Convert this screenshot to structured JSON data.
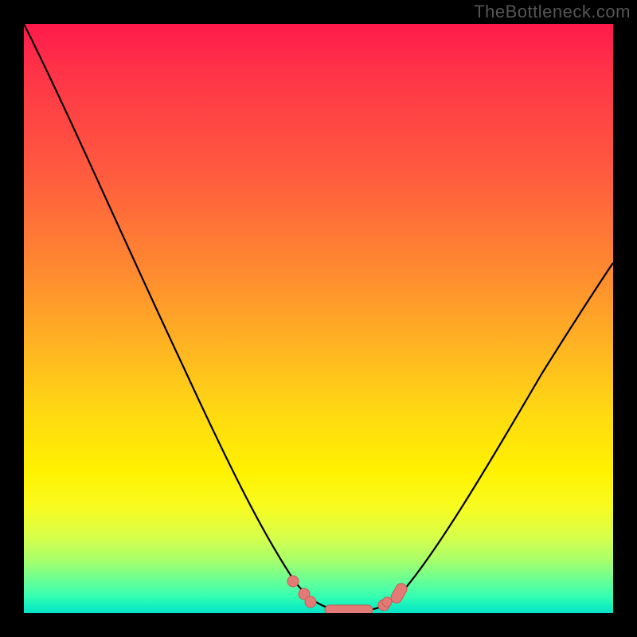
{
  "watermark": "TheBottleneck.com",
  "colors": {
    "page_bg": "#000000",
    "curve_stroke": "#000000",
    "marker_fill": "#e47a76",
    "marker_stroke": "#c85a56"
  },
  "chart_data": {
    "type": "line",
    "title": "",
    "xlabel": "",
    "ylabel": "",
    "xlim": [
      0,
      100
    ],
    "ylim": [
      0,
      100
    ],
    "grid": false,
    "legend": false,
    "background_gradient": "red-yellow-green (vertical, red=high, green=low)",
    "series": [
      {
        "name": "bottleneck-curve",
        "x": [
          0,
          5,
          10,
          15,
          20,
          25,
          30,
          35,
          40,
          45,
          48,
          50,
          52,
          55,
          58,
          60,
          62,
          65,
          70,
          75,
          80,
          85,
          90,
          95,
          100
        ],
        "values": [
          100,
          92,
          83,
          73,
          63,
          53,
          42,
          31,
          20,
          10,
          5,
          2,
          1,
          1,
          1,
          2,
          5,
          9,
          17,
          25,
          32,
          39,
          45,
          51,
          56
        ]
      }
    ],
    "markers": {
      "comment": "highlighted points near the curve minimum",
      "x": [
        45,
        47,
        49,
        51,
        53,
        55,
        58,
        60,
        62
      ],
      "values": [
        10,
        6,
        3,
        1,
        1,
        1,
        3,
        5,
        8
      ]
    }
  }
}
